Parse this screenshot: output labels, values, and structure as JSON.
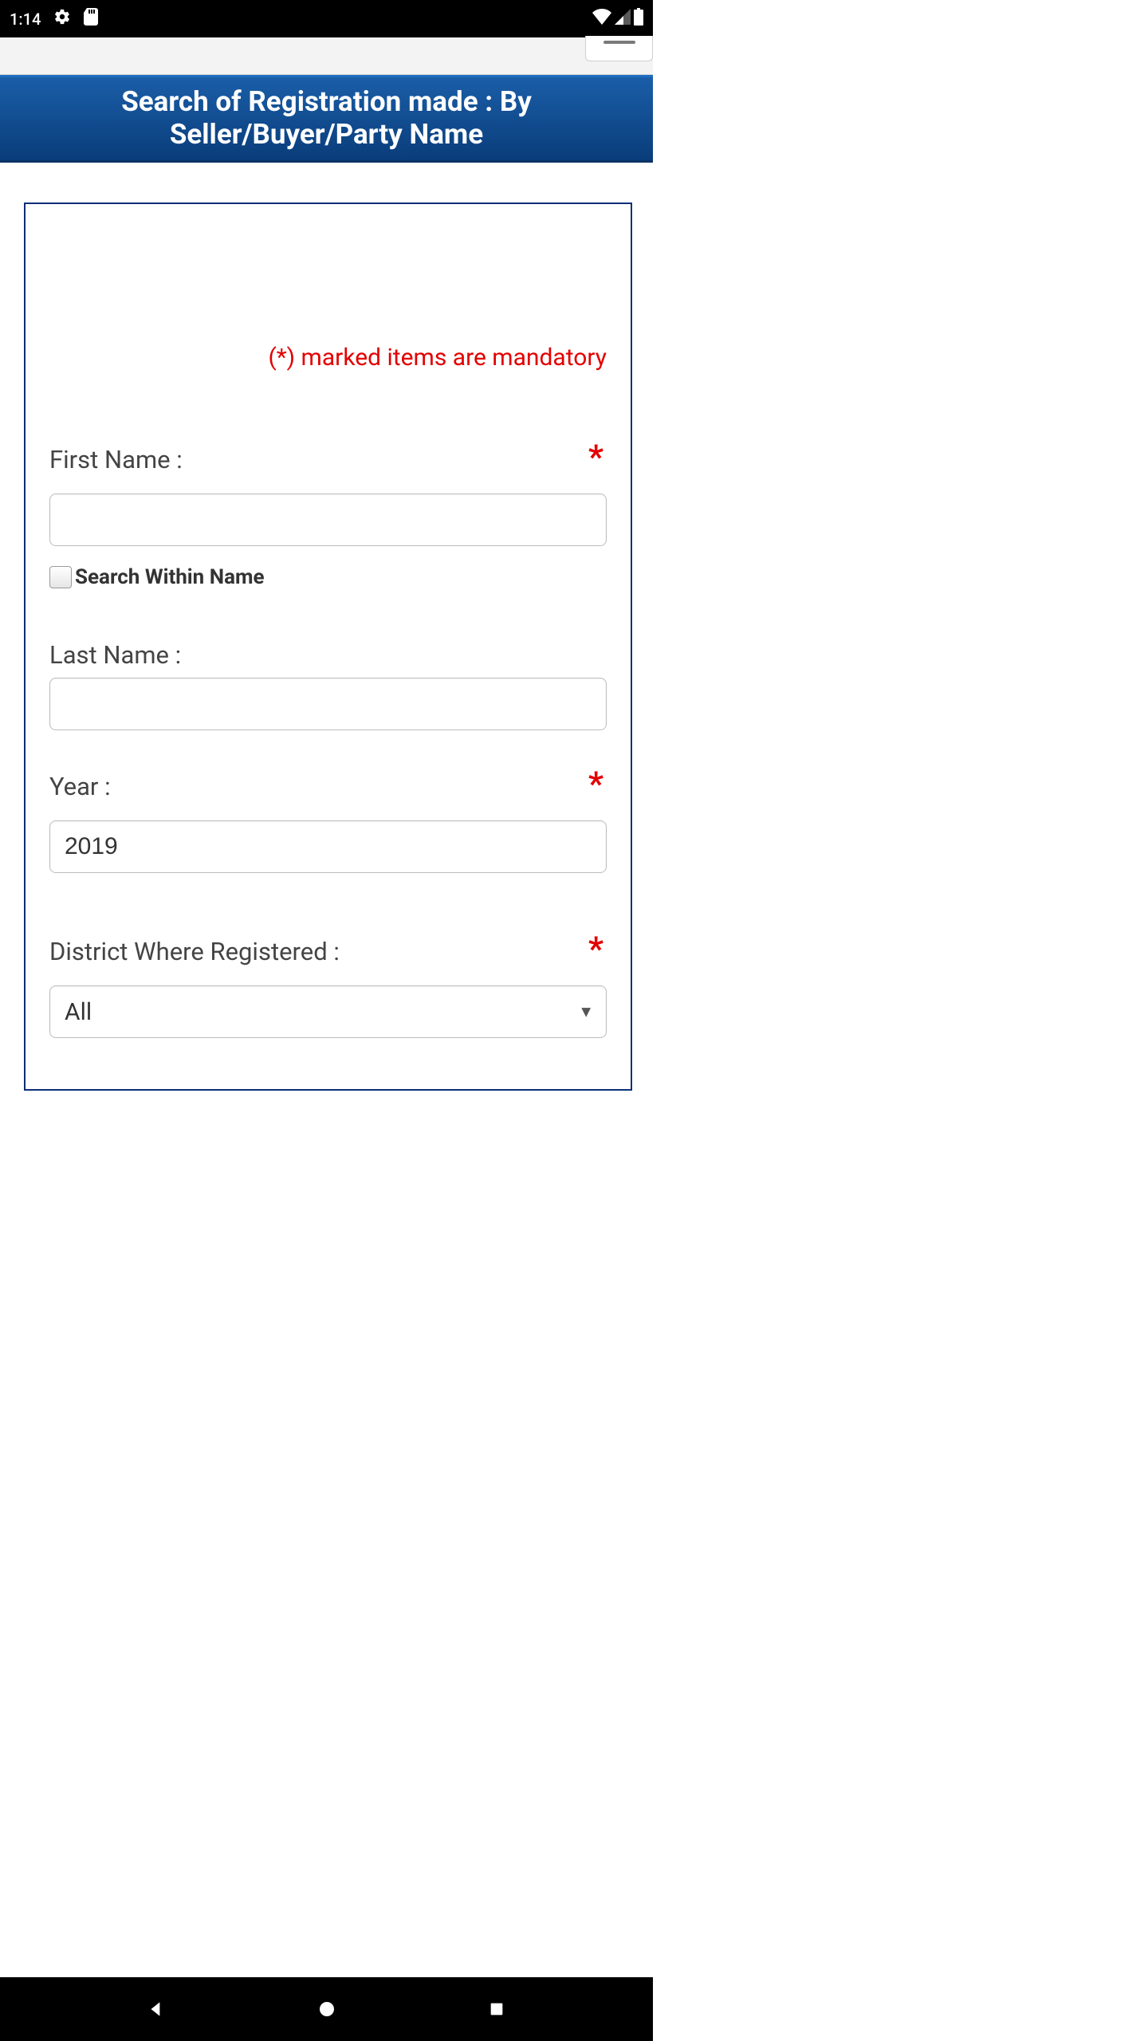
{
  "status": {
    "time": "1:14"
  },
  "header": {
    "title": "Search of Registration made : By Seller/Buyer/Party Name"
  },
  "form": {
    "mandatory_note": "(*) marked items are mandatory",
    "first_name_label": "First Name :",
    "first_name_value": "",
    "search_within_name_label": "Search Within Name",
    "last_name_label": "Last Name :",
    "last_name_value": "",
    "year_label": "Year :",
    "year_value": "2019",
    "district_label": "District Where Registered :",
    "district_value": "All",
    "asterisk": "*"
  }
}
